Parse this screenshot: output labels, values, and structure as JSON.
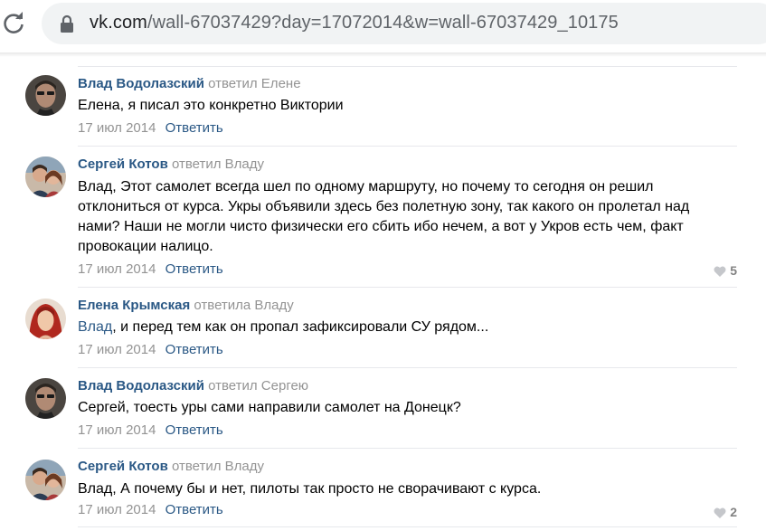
{
  "browser": {
    "url_domain": "vk.com",
    "url_path": "/wall-67037429?day=17072014&w=wall-67037429_10175"
  },
  "comments": [
    {
      "author": "Влад Водолазский",
      "reply_to": "ответил Елене",
      "text_link": "",
      "text": "Елена, я писал это конкретно Виктории",
      "date": "17 июл 2014",
      "reply_label": "Ответить",
      "likes": ""
    },
    {
      "author": "Сергей Котов",
      "reply_to": "ответил Владу",
      "text_link": "",
      "text": "Влад, Этот самолет всегда шел по одному маршруту, но почему то сегодня он решил отклониться от курса. Укры объявили здесь без полетную зону, так какого он пролетал над нами? Наши не могли чисто физически его сбить ибо нечем, а вот у Укров есть чем, факт провокации налицо.",
      "date": "17 июл 2014",
      "reply_label": "Ответить",
      "likes": "5"
    },
    {
      "author": "Елена Крымская",
      "reply_to": "ответила Владу",
      "text_link": "Влад",
      "text": ", и перед тем как он пропал зафиксировали СУ рядом...",
      "date": "17 июл 2014",
      "reply_label": "Ответить",
      "likes": ""
    },
    {
      "author": "Влад Водолазский",
      "reply_to": "ответил Сергею",
      "text_link": "",
      "text": "Сергей, тоесть уры сами направили самолет на Донецк?",
      "date": "17 июл 2014",
      "reply_label": "Ответить",
      "likes": ""
    },
    {
      "author": "Сергей Котов",
      "reply_to": "ответил Владу",
      "text_link": "",
      "text": "Влад, А почему бы и нет, пилоты так просто не сворачивают с курса.",
      "date": "17 июл 2014",
      "reply_label": "Ответить",
      "likes": "2"
    }
  ]
}
